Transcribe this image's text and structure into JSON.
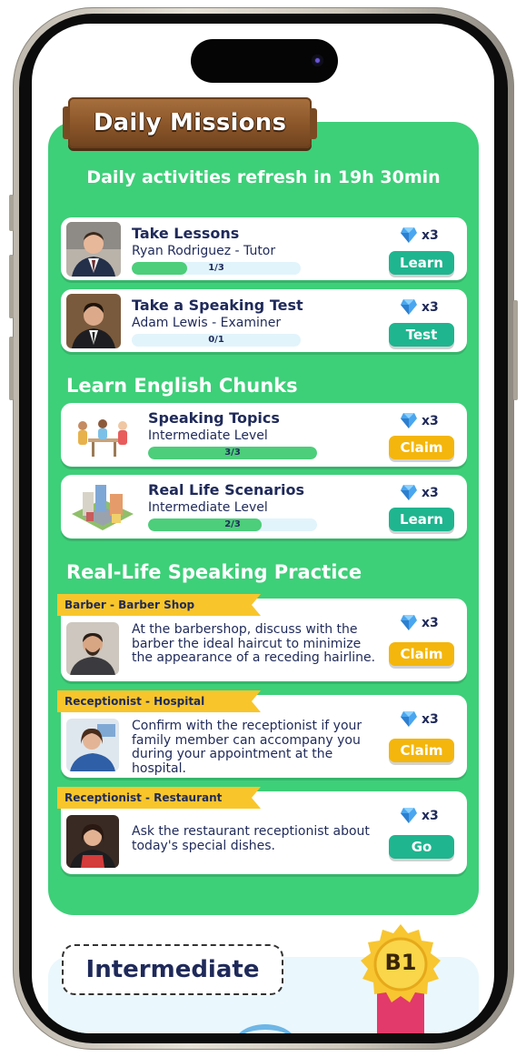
{
  "header": {
    "title": "Daily Missions",
    "refresh": "Daily activities refresh in 19h 30min"
  },
  "colors": {
    "panel_green": "#3ecf79",
    "button_teal": "#1fb58f",
    "button_yellow": "#f4b60c",
    "tag_yellow": "#f8c62b",
    "text_navy": "#1f2a5a"
  },
  "daily_missions": [
    {
      "title": "Take Lessons",
      "subtitle": "Ryan Rodriguez - Tutor",
      "progress_text": "1/3",
      "progress": 0.33,
      "reward": "x3",
      "button": "Learn",
      "button_color": "teal",
      "icon": "tutor-avatar"
    },
    {
      "title": "Take a Speaking Test",
      "subtitle": "Adam Lewis - Examiner",
      "progress_text": "0/1",
      "progress": 0.0,
      "reward": "x3",
      "button": "Test",
      "button_color": "teal",
      "icon": "examiner-avatar"
    }
  ],
  "chunks": {
    "title": "Learn English Chunks",
    "items": [
      {
        "title": "Speaking Topics",
        "subtitle": "Intermediate Level",
        "progress_text": "3/3",
        "progress": 1.0,
        "reward": "x3",
        "button": "Claim",
        "button_color": "yellow",
        "icon": "people-talking-illustration"
      },
      {
        "title": "Real Life Scenarios",
        "subtitle": "Intermediate Level",
        "progress_text": "2/3",
        "progress": 0.67,
        "reward": "x3",
        "button": "Learn",
        "button_color": "teal",
        "icon": "city-blocks-illustration"
      }
    ]
  },
  "practice": {
    "title": "Real-Life Speaking Practice",
    "items": [
      {
        "tag": "Barber - Barber Shop",
        "description": "At the barbershop, discuss with the barber the ideal haircut to minimize the appearance of a receding hairline.",
        "reward": "x3",
        "button": "Claim",
        "button_color": "yellow",
        "icon": "barber-avatar"
      },
      {
        "tag": "Receptionist - Hospital",
        "description": "Confirm with the receptionist if your family member can accompany you during your appointment at the hospital.",
        "reward": "x3",
        "button": "Claim",
        "button_color": "yellow",
        "icon": "hospital-receptionist-avatar"
      },
      {
        "tag": "Receptionist - Restaurant",
        "description": "Ask the restaurant receptionist about today's special dishes.",
        "reward": "x3",
        "button": "Go",
        "button_color": "teal",
        "icon": "restaurant-receptionist-avatar"
      }
    ]
  },
  "level": {
    "label": "Intermediate",
    "badge": "B1"
  }
}
